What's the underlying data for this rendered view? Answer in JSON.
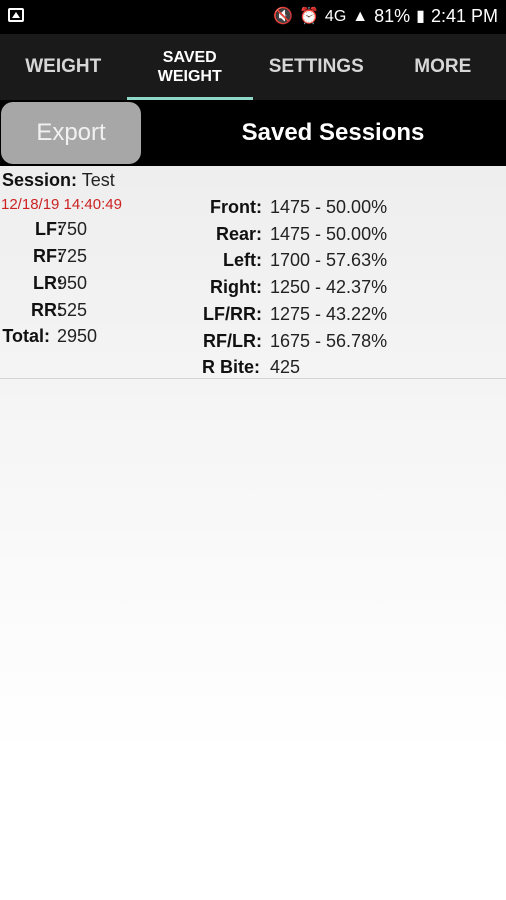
{
  "status": {
    "battery": "81%",
    "time": "2:41 PM",
    "network": "4G"
  },
  "tabs": [
    {
      "label": "WEIGHT"
    },
    {
      "label": "SAVED\nWEIGHT"
    },
    {
      "label": "SETTINGS"
    },
    {
      "label": "MORE"
    }
  ],
  "header": {
    "export_label": "Export",
    "title": "Saved Sessions"
  },
  "session": {
    "session_label": "Session:",
    "session_name": "Test",
    "date": "12/18/19 14:40:49",
    "corners": [
      {
        "label": "LF:",
        "value": "750"
      },
      {
        "label": "RF:",
        "value": "725"
      },
      {
        "label": "LR:",
        "value": "950"
      },
      {
        "label": "RR:",
        "value": "525"
      },
      {
        "label": "Total:",
        "value": "2950"
      }
    ],
    "stats": [
      {
        "label": "Front:",
        "value": "1475 - 50.00%"
      },
      {
        "label": "Rear:",
        "value": "1475 - 50.00%"
      },
      {
        "label": "Left:",
        "value": "1700 - 57.63%"
      },
      {
        "label": "Right:",
        "value": "1250 - 42.37%"
      },
      {
        "label": "LF/RR:",
        "value": "1275 - 43.22%"
      },
      {
        "label": "RF/LR:",
        "value": "1675 - 56.78%"
      },
      {
        "label": "R Bite:",
        "value": "425"
      }
    ]
  }
}
